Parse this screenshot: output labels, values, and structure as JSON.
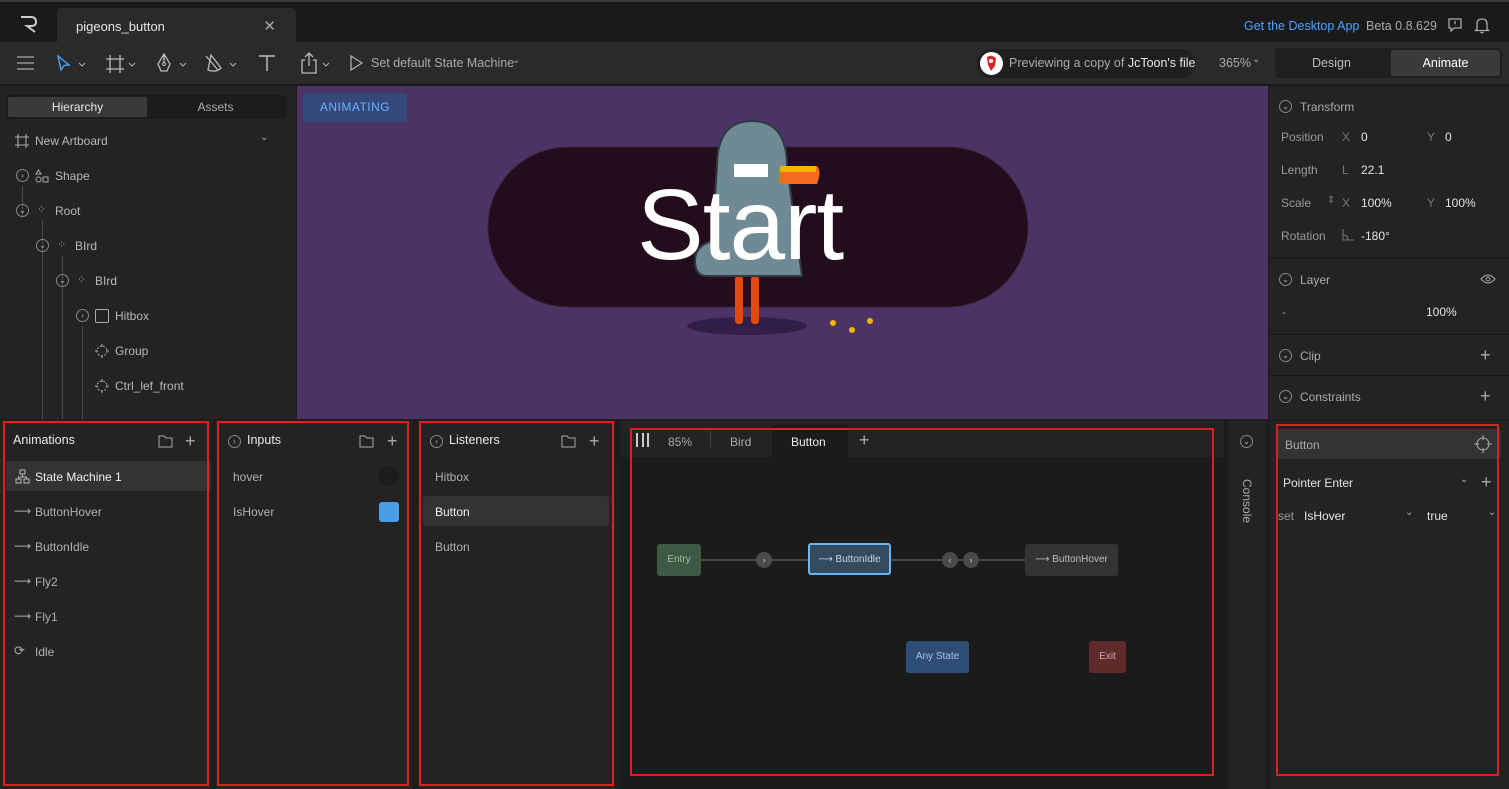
{
  "app": {
    "file_tab": "pigeons_button",
    "get_desktop": "Get the Desktop App",
    "version": "Beta 0.8.629"
  },
  "toolbar": {
    "state_machine_label": "Set default State Machine",
    "preview_prefix": "Previewing a copy of ",
    "preview_owner": "JcToon's file",
    "zoom": "365%",
    "mode_design": "Design",
    "mode_animate": "Animate"
  },
  "hierarchy": {
    "tab_hierarchy": "Hierarchy",
    "tab_assets": "Assets",
    "artboard": "New Artboard",
    "items": [
      {
        "label": "Shape"
      },
      {
        "label": "Root"
      },
      {
        "label": "BIrd"
      },
      {
        "label": "BIrd"
      },
      {
        "label": "Hitbox"
      },
      {
        "label": "Group"
      },
      {
        "label": "Ctrl_lef_front"
      }
    ]
  },
  "stage": {
    "badge": "ANIMATING",
    "button_text": "Start"
  },
  "transform": {
    "title": "Transform",
    "position_label": "Position",
    "position_x": "0",
    "position_y": "0",
    "length_label": "Length",
    "length_value": "22.1",
    "scale_label": "Scale",
    "scale_x": "100%",
    "scale_y": "100%",
    "rotation_label": "Rotation",
    "rotation_value": "-180°",
    "x": "X",
    "y": "Y",
    "l": "L"
  },
  "layer": {
    "title": "Layer",
    "blend": "-",
    "opacity": "100%"
  },
  "clip": {
    "title": "Clip"
  },
  "constraints": {
    "title": "Constraints"
  },
  "animations": {
    "title": "Animations",
    "items": [
      {
        "label": "State Machine 1",
        "icon": "state-machine-icon"
      },
      {
        "label": "ButtonHover",
        "icon": "arrow-icon"
      },
      {
        "label": "ButtonIdle",
        "icon": "arrow-icon"
      },
      {
        "label": "Fly2",
        "icon": "arrow-icon"
      },
      {
        "label": "Fly1",
        "icon": "arrow-icon"
      },
      {
        "label": "Idle",
        "icon": "loop-icon"
      }
    ]
  },
  "inputs": {
    "title": "Inputs",
    "items": [
      {
        "label": "hover",
        "type": "trigger"
      },
      {
        "label": "IsHover",
        "type": "boolean"
      }
    ]
  },
  "listeners": {
    "title": "Listeners",
    "items": [
      {
        "label": "Hitbox"
      },
      {
        "label": "Button"
      },
      {
        "label": "Button"
      }
    ]
  },
  "graph": {
    "zoom": "85%",
    "tabs": [
      "Bird",
      "Button"
    ],
    "nodes": {
      "entry": "Entry",
      "idle": "ButtonIdle",
      "hover": "ButtonHover",
      "any": "Any State",
      "exit": "Exit"
    }
  },
  "console": {
    "label": "Console"
  },
  "listener_props": {
    "target": "Button",
    "event": "Pointer Enter",
    "action_set": "set",
    "action_input": "IsHover",
    "action_value": "true"
  },
  "colors": {
    "accent": "#4aa3ff",
    "stage_bg": "#4b3465",
    "highlight": "#e0201c"
  }
}
